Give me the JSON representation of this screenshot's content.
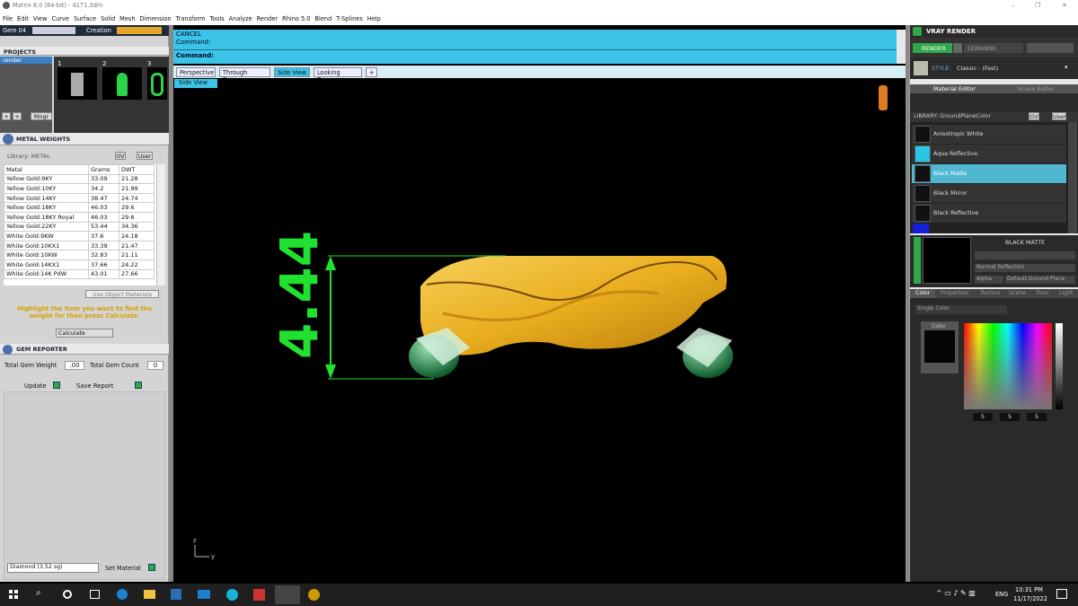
{
  "window": {
    "title": "Matrix 8.0 (64-bit) - 4171.3dm",
    "controls": [
      "–",
      "❐",
      "✕"
    ]
  },
  "menu": [
    "File",
    "Edit",
    "View",
    "Curve",
    "Surface",
    "Solid",
    "Mesh",
    "Dimension",
    "Transform",
    "Tools",
    "Analyze",
    "Render",
    "Rhino 5.0",
    "Blend",
    "T-Splines",
    "Help"
  ],
  "left": {
    "gem_dropdown": "Gem 04",
    "creation_dropdown": "Creation",
    "projects_title": "PROJECTS",
    "project_item": "render",
    "thumbs": [
      "1",
      "2",
      "3"
    ],
    "mngr_btn": "Mngr",
    "metal_title": "METAL WEIGHTS",
    "library_label": "Library: METAL",
    "gv_label": "GV",
    "user_label": "User",
    "table_headers": [
      "Metal",
      "Grams",
      "DWT"
    ],
    "rows": [
      [
        "Yellow Gold:9KY",
        "33.09",
        "21.28"
      ],
      [
        "Yellow Gold:10KY",
        "34.2",
        "21.99"
      ],
      [
        "Yellow Gold:14KY",
        "38.47",
        "24.74"
      ],
      [
        "Yellow Gold:18KY",
        "46.03",
        "29.6"
      ],
      [
        "Yellow Gold:18KY Royal",
        "46.03",
        "29.6"
      ],
      [
        "Yellow Gold:22KY",
        "53.44",
        "34.36"
      ],
      [
        "White Gold:9KW",
        "37.6",
        "24.18"
      ],
      [
        "White Gold:10KX1",
        "33.39",
        "21.47"
      ],
      [
        "White Gold:10KW",
        "32.83",
        "21.11"
      ],
      [
        "White Gold:14KX1",
        "37.66",
        "24.22"
      ],
      [
        "White Gold:14K PdW",
        "43.01",
        "27.66"
      ]
    ],
    "use_object_materials": "Use Object Materials",
    "hint": "Highlight the item you want to find the weight for then press Calculate.",
    "calculate": "Calculate",
    "gem_reporter_title": "GEM REPORTER",
    "total_gem_weight_label": "Total Gem Weight",
    "total_gem_weight": ".00",
    "total_gem_count_label": "Total Gem Count",
    "total_gem_count": "0",
    "update": "Update",
    "save_report": "Save Report",
    "diamond_select": "Diamond    (3.52 sg)",
    "set_material": "Set Material"
  },
  "command": {
    "line1": "CANCEL",
    "line2": "Command:",
    "prompt": "Command:"
  },
  "viewtabs": [
    "Perspective",
    "Through Finger",
    "Side View",
    "Looking Down"
  ],
  "active_viewtab": "Side View",
  "viewport_label": "Side View",
  "dimension_text": "4.44",
  "axis": {
    "z": "z",
    "y": "y"
  },
  "right": {
    "title": "VRAY RENDER",
    "render_btn": "RENDER",
    "resolution": "1200x900",
    "style_label": "STYLE:",
    "style_value": "Classic - (Fast)",
    "tabs": [
      "Material Editor",
      "Scene Editor"
    ],
    "library": "LIBRARY: GroundPlaneColor",
    "gv_label": "GV",
    "user_label": "User",
    "materials": [
      "Anisotropic White",
      "Aqua Reflective",
      "Black Matte",
      "Black Mirror",
      "Black Reflective"
    ],
    "selected_material": "Black Matte",
    "material_name": "BLACK MATTE",
    "normal_reflection": "Normal Reflection",
    "alpha": "Alpha",
    "default_ground": "Default:Ground Plane",
    "subtabs": [
      "Color",
      "Properties",
      "Texture",
      "Scene",
      "Toon",
      "Light"
    ],
    "single_color": "Single Color",
    "color_label": "Color",
    "rgb": [
      "5",
      "5",
      "5"
    ],
    "colors": {
      "accent": "#3cc4e8",
      "selected": "#4fb8d0",
      "aqua": "#29c6e6",
      "green": "#2ea84a"
    }
  },
  "taskbar": {
    "lang": "ENG",
    "time": "10:31 PM",
    "date": "11/17/2022"
  }
}
